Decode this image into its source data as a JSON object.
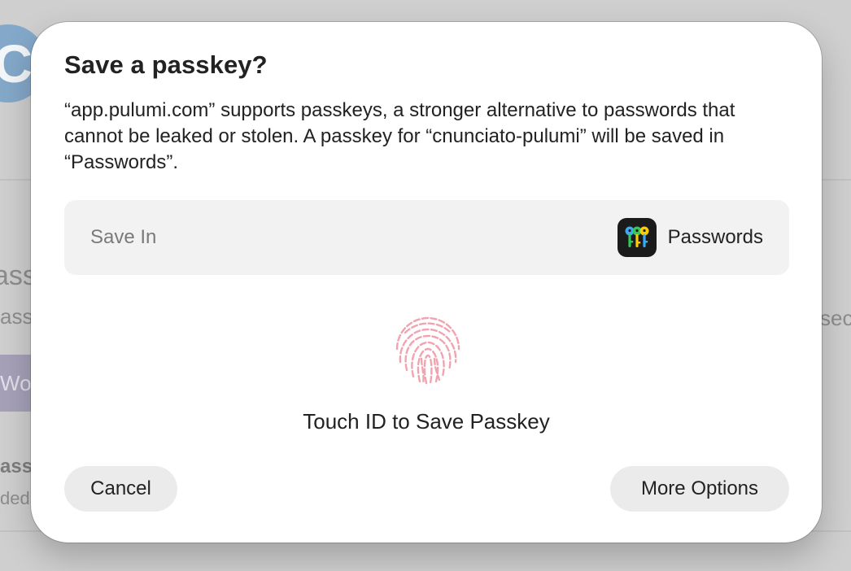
{
  "background": {
    "avatar_letter": "C",
    "fragments": [
      "ass",
      "assk",
      "Wo",
      "ass",
      "ded",
      "sec"
    ]
  },
  "dialog": {
    "title": "Save a passkey?",
    "description": "“app.pulumi.com” supports passkeys, a stronger alternative to passwords that cannot be leaked or stolen. A passkey for “cnunciato-pulumi” will be saved in “Passwords”.",
    "save_in": {
      "label": "Save In",
      "value": "Passwords",
      "icon": "passwords-app-icon"
    },
    "touch_id": {
      "icon": "fingerprint-icon",
      "label": "Touch ID to Save Passkey",
      "color": "#f2a3b0"
    },
    "buttons": {
      "cancel": "Cancel",
      "more_options": "More Options"
    }
  }
}
